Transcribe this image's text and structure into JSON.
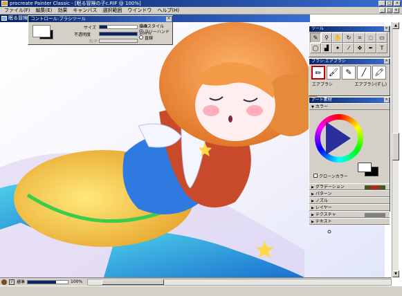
{
  "window": {
    "title": "procreate Painter Classic - [眠る冒険の子c.RIF @ 100%]",
    "minimize": "_",
    "maximize": "□",
    "close": "×"
  },
  "menu": {
    "items": [
      "ファイル(F)",
      "編集(E)",
      "効果",
      "キャンバス",
      "選択範囲",
      "ウインドウ",
      "ヘルプ(H)"
    ]
  },
  "document": {
    "title": "眠る冒険の子c.RIF @ 100%"
  },
  "control_panel": {
    "title": "コントロール:ブラシツール",
    "close": "×",
    "size_label": "サイズ",
    "size_value": "2.0",
    "size_fraction": 0.2,
    "opacity_label": "不透明度",
    "opacity_value": "100%",
    "opacity_fraction": 1.0,
    "grain_label": "粒子",
    "grain_value": "",
    "stroke_style_label": "描画スタイル",
    "freehand_label": "フリーハンド",
    "straight_label": "直線",
    "selected_style": "freehand"
  },
  "tools_palette": {
    "title": "ツール",
    "close": "×",
    "tools": [
      {
        "name": "brush-tool",
        "glyph": "✎"
      },
      {
        "name": "magnifier-tool",
        "glyph": "⚲"
      },
      {
        "name": "grabber-tool",
        "glyph": "✋"
      },
      {
        "name": "rotate-tool",
        "glyph": "↻"
      },
      {
        "name": "crop-tool",
        "glyph": "⌗"
      },
      {
        "name": "lasso-tool",
        "glyph": "◌"
      },
      {
        "name": "rect-select-tool",
        "glyph": "▭"
      },
      {
        "name": "oval-select-tool",
        "glyph": "◯"
      },
      {
        "name": "paint-bucket-tool",
        "glyph": "▟"
      },
      {
        "name": "wand-tool",
        "glyph": "✦"
      },
      {
        "name": "dropper-tool",
        "glyph": "⁄"
      },
      {
        "name": "layer-adjuster-tool",
        "glyph": "✥"
      },
      {
        "name": "pen-tool",
        "glyph": "✒"
      },
      {
        "name": "text-tool",
        "glyph": "T"
      }
    ],
    "active_tool": 0
  },
  "brushes_palette": {
    "title": "ブラシ:エアブラシ",
    "close": "×",
    "brushes": [
      {
        "name": "brush-variant-1",
        "glyph": "✏"
      },
      {
        "name": "brush-variant-2",
        "glyph": "🖌"
      },
      {
        "name": "brush-variant-3",
        "glyph": "✎"
      },
      {
        "name": "brush-variant-4",
        "glyph": "╱"
      },
      {
        "name": "brush-variant-5",
        "glyph": "🖍"
      }
    ],
    "active_brush": 0,
    "category_label": "エアブラシ",
    "variant_label": "エアブラシ(ずし)"
  },
  "art_materials": {
    "title": "アート素材",
    "close": "×",
    "color_label": "カラー",
    "clone_color_label": "クローンカラー",
    "sections": [
      "グラデーション",
      "パターン",
      "ノズル",
      "レイヤー",
      "テクスチャ",
      "テキスト"
    ]
  },
  "status": {
    "zoom_label": "標準",
    "zoom_value": "100%"
  },
  "colors": {
    "titlebar": "#0a2466",
    "chrome": "#d4d0c8"
  }
}
